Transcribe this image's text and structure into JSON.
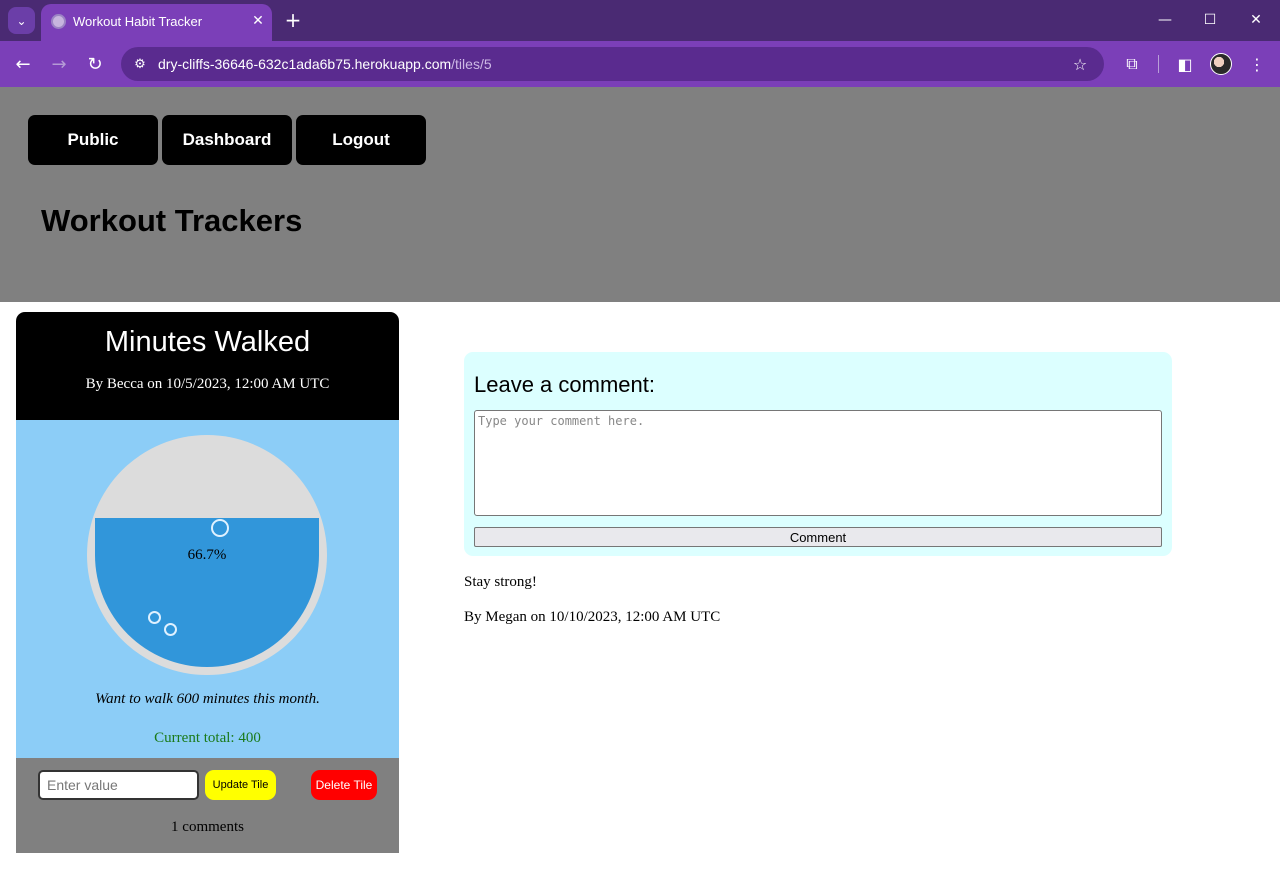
{
  "browser": {
    "tab_title": "Workout Habit Tracker",
    "url_host": "dry-cliffs-36646-632c1ada6b75.herokuapp.com",
    "url_path": "/tiles/5",
    "icons": {
      "tab_menu": "chevron-down-icon",
      "tab_close": "close-icon",
      "new_tab": "plus-icon",
      "back": "arrow-left-icon",
      "forward": "arrow-right-icon",
      "reload": "reload-icon",
      "site_info": "tune-icon",
      "bookmark": "star-icon",
      "extensions": "puzzle-icon",
      "side_panel": "side-panel-icon",
      "menu": "kebab-icon"
    }
  },
  "header": {
    "nav": [
      "Public",
      "Dashboard",
      "Logout"
    ],
    "title": "Workout Trackers"
  },
  "tile": {
    "title": "Minutes Walked",
    "byline": "By Becca on 10/5/2023, 12:00 AM UTC",
    "progress_fraction": 0.667,
    "progress_label": "66.7%",
    "goal": "Want to walk 600 minutes this month.",
    "total": "Current total: 400",
    "value_placeholder": "Enter value",
    "update_label": "Update Tile",
    "delete_label": "Delete Tile",
    "comments_count": "1 comments"
  },
  "comment_form": {
    "heading": "Leave a comment:",
    "placeholder": "Type your comment here.",
    "button_label": "Comment"
  },
  "comments": [
    {
      "text": "Stay strong!",
      "byline": "By Megan on 10/10/2023, 12:00 AM UTC"
    }
  ],
  "colors": {
    "browser_frame": "#7b3fb8",
    "header_bg": "#808080",
    "tile_body": "#8ccdf7",
    "gauge_fill": "#3196da",
    "update_button": "#ffff00",
    "delete_button": "#ff0000",
    "comment_box": "#dcffff",
    "total_text": "#1a7a1a"
  }
}
